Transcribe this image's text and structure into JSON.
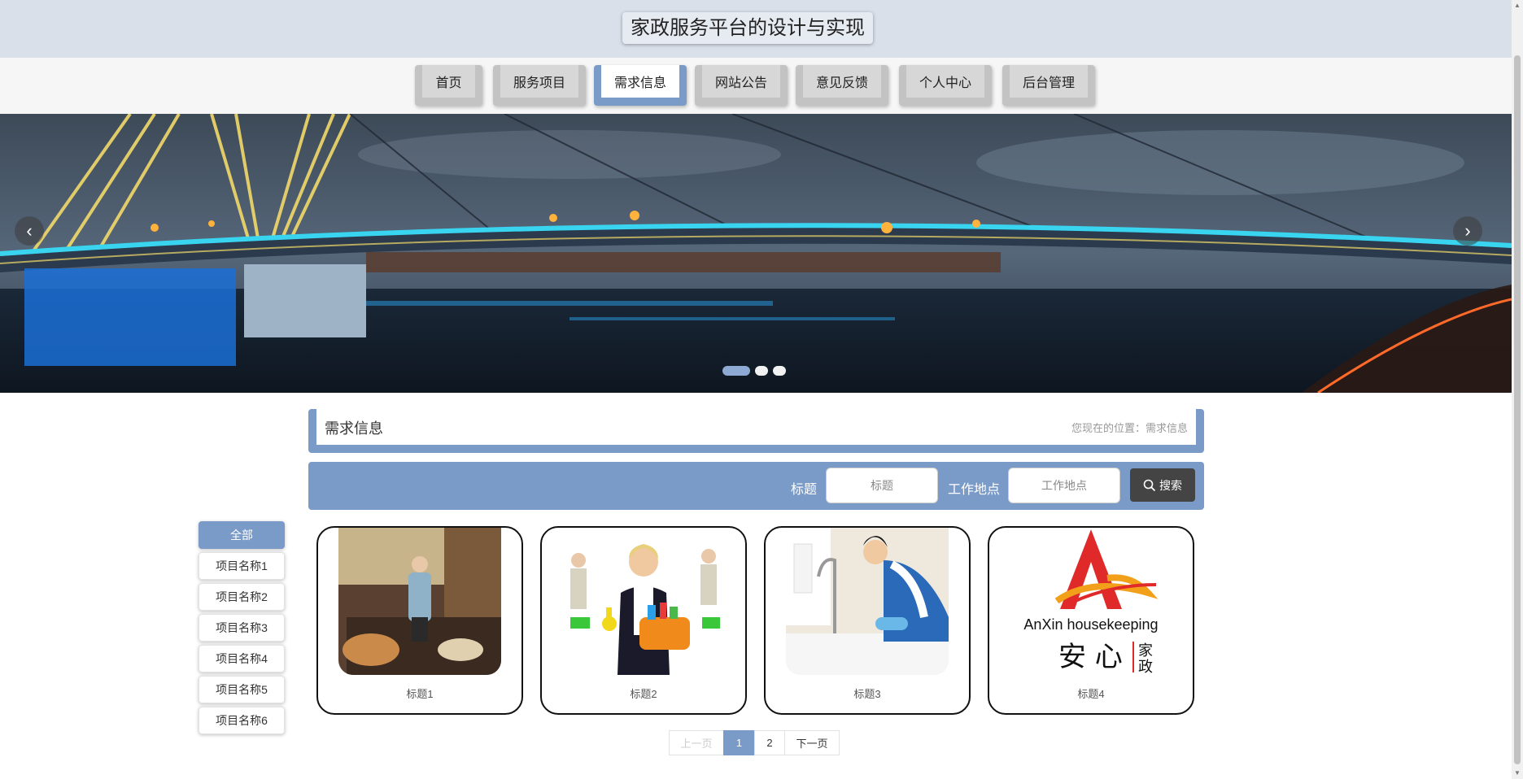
{
  "header": {
    "title": "家政服务平台的设计与实现"
  },
  "nav": {
    "items": [
      {
        "label": "首页"
      },
      {
        "label": "服务项目"
      },
      {
        "label": "需求信息",
        "active": true
      },
      {
        "label": "网站公告"
      },
      {
        "label": "意见反馈"
      },
      {
        "label": "个人中心"
      },
      {
        "label": "后台管理"
      }
    ]
  },
  "banner": {
    "slides": 3,
    "active_slide": 1,
    "prev_icon": "chevron-left-icon",
    "next_icon": "chevron-right-icon"
  },
  "page": {
    "title": "需求信息",
    "breadcrumb_prefix": "您现在的位置：",
    "breadcrumb_current": "需求信息"
  },
  "search": {
    "title_label": "标题",
    "title_placeholder": "标题",
    "location_label": "工作地点",
    "location_placeholder": "工作地点",
    "button_label": "搜索",
    "button_icon": "search-icon"
  },
  "categories": [
    {
      "label": "全部",
      "active": true
    },
    {
      "label": "项目名称1"
    },
    {
      "label": "项目名称2"
    },
    {
      "label": "项目名称3"
    },
    {
      "label": "项目名称4"
    },
    {
      "label": "项目名称5"
    },
    {
      "label": "项目名称6"
    }
  ],
  "cards": [
    {
      "title": "标题1"
    },
    {
      "title": "标题2"
    },
    {
      "title": "标题3"
    },
    {
      "title": "标题4",
      "logo": {
        "brand_latin": "AnXin housekeeping",
        "brand_cn": "安 心",
        "brand_cn2a": "家",
        "brand_cn2b": "政"
      }
    }
  ],
  "pagination": {
    "prev": "上一页",
    "pages": [
      "1",
      "2"
    ],
    "current": "1",
    "next": "下一页"
  },
  "colors": {
    "accent": "#7a9bc8",
    "header_bg": "#d9e0ea",
    "dark_button": "#444444"
  }
}
